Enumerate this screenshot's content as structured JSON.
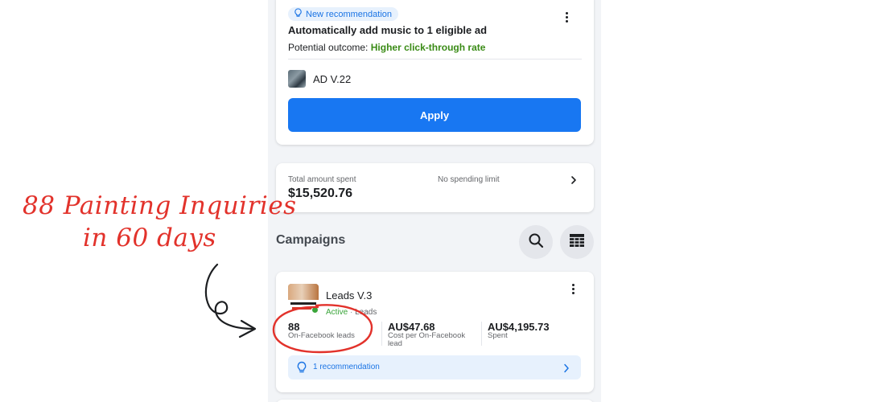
{
  "recommendation_card": {
    "badge": "New recommendation",
    "title": "Automatically add music to 1 eligible ad",
    "outcome_label": "Potential outcome:",
    "outcome_value": "Higher click-through rate",
    "ad_name": "AD V.22",
    "apply_label": "Apply"
  },
  "spend_card": {
    "total_label": "Total amount spent",
    "total_value": "$15,520.76",
    "limit_text": "No spending limit"
  },
  "campaigns": {
    "heading": "Campaigns",
    "items": [
      {
        "name": "Leads V.3",
        "status": "Active",
        "objective": "Leads",
        "metrics": [
          {
            "value": "88",
            "label": "On-Facebook leads"
          },
          {
            "value": "AU$47.68",
            "label": "Cost per On-Facebook lead"
          },
          {
            "value": "AU$4,195.73",
            "label": "Spent"
          }
        ],
        "recommendation_text": "1 recommendation"
      }
    ]
  },
  "annotation": {
    "line1": "88 Painting Inquiries",
    "line2": "in 60 days"
  },
  "colors": {
    "accent": "#1877f2",
    "positive": "#3a8b16",
    "active_status": "#3aa53a",
    "annotation": "#e2322b"
  }
}
